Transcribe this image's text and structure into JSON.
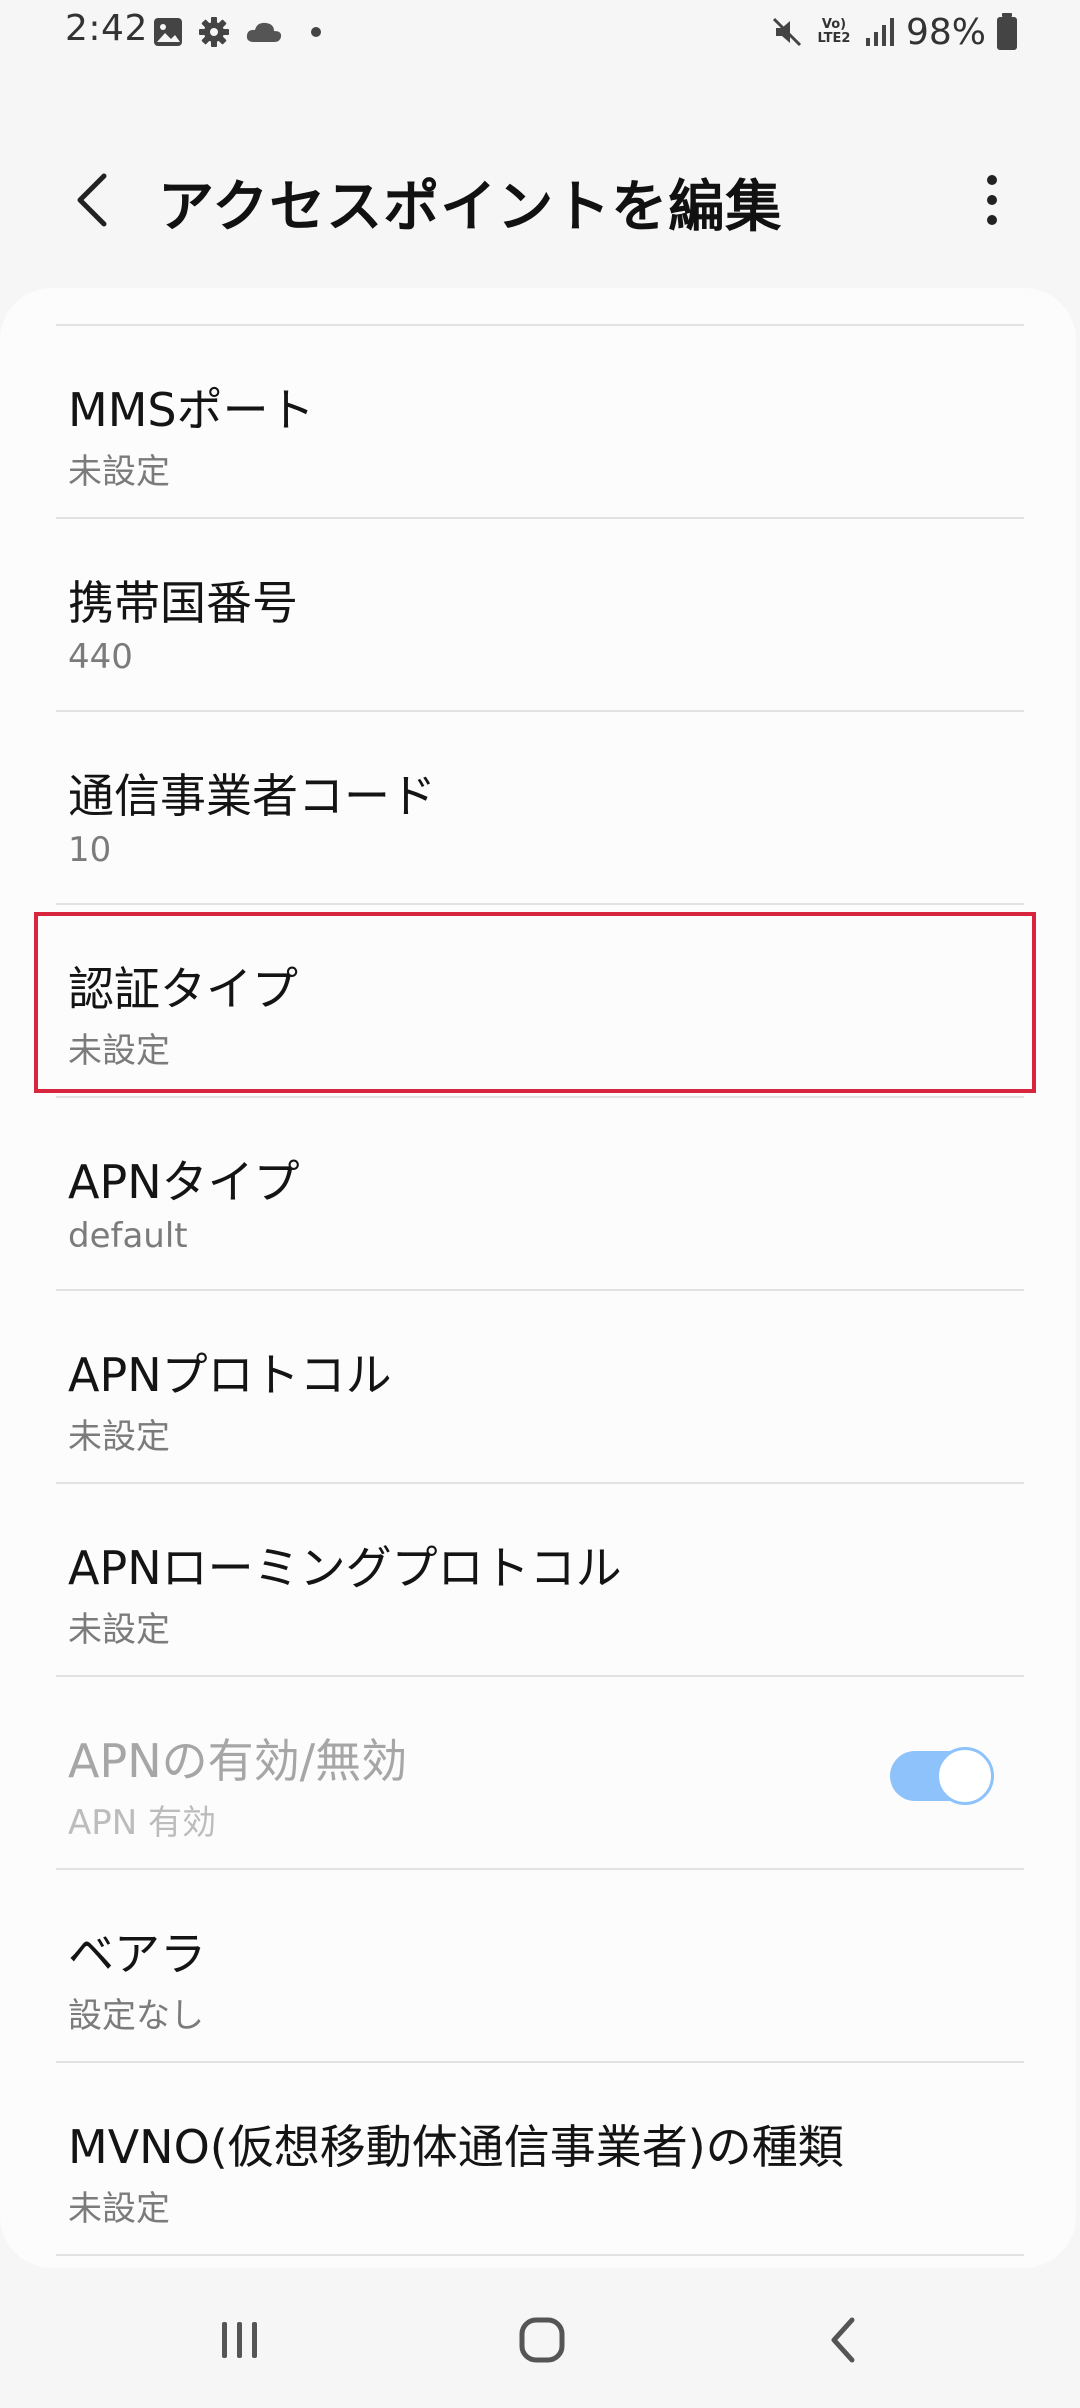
{
  "status_bar": {
    "time": "2:42",
    "network_label": "Vo) LTE2",
    "battery_percent": "98%"
  },
  "header": {
    "title": "アクセスポイントを編集"
  },
  "settings": {
    "items": [
      {
        "title": "MMSポート",
        "summary": "未設定"
      },
      {
        "title": "携帯国番号",
        "summary": "440"
      },
      {
        "title": "通信事業者コード",
        "summary": "10"
      },
      {
        "title": "認証タイプ",
        "summary": "未設定",
        "highlighted": true
      },
      {
        "title": "APNタイプ",
        "summary": "default"
      },
      {
        "title": "APNプロトコル",
        "summary": "未設定"
      },
      {
        "title": "APNローミングプロトコル",
        "summary": "未設定"
      },
      {
        "title": "APNの有効/無効",
        "summary": "APN 有効",
        "disabled": true,
        "toggle_on": true
      },
      {
        "title": "ベアラ",
        "summary": "設定なし"
      },
      {
        "title": "MVNO(仮想移動体通信事業者)の種類",
        "summary": "未設定"
      }
    ]
  },
  "colors": {
    "highlight": "#d7263d",
    "toggle_accent": "#8ec2fb",
    "background": "#f6f6f6",
    "card": "#fcfcfc"
  },
  "icons": {
    "status": [
      "gallery-icon",
      "gear-icon",
      "cloud-icon",
      "dot-icon",
      "mute-icon",
      "signal-icon",
      "battery-icon"
    ],
    "header": [
      "back-chevron-icon",
      "more-vertical-icon"
    ],
    "nav": [
      "recents-icon",
      "home-icon",
      "back-icon"
    ]
  }
}
